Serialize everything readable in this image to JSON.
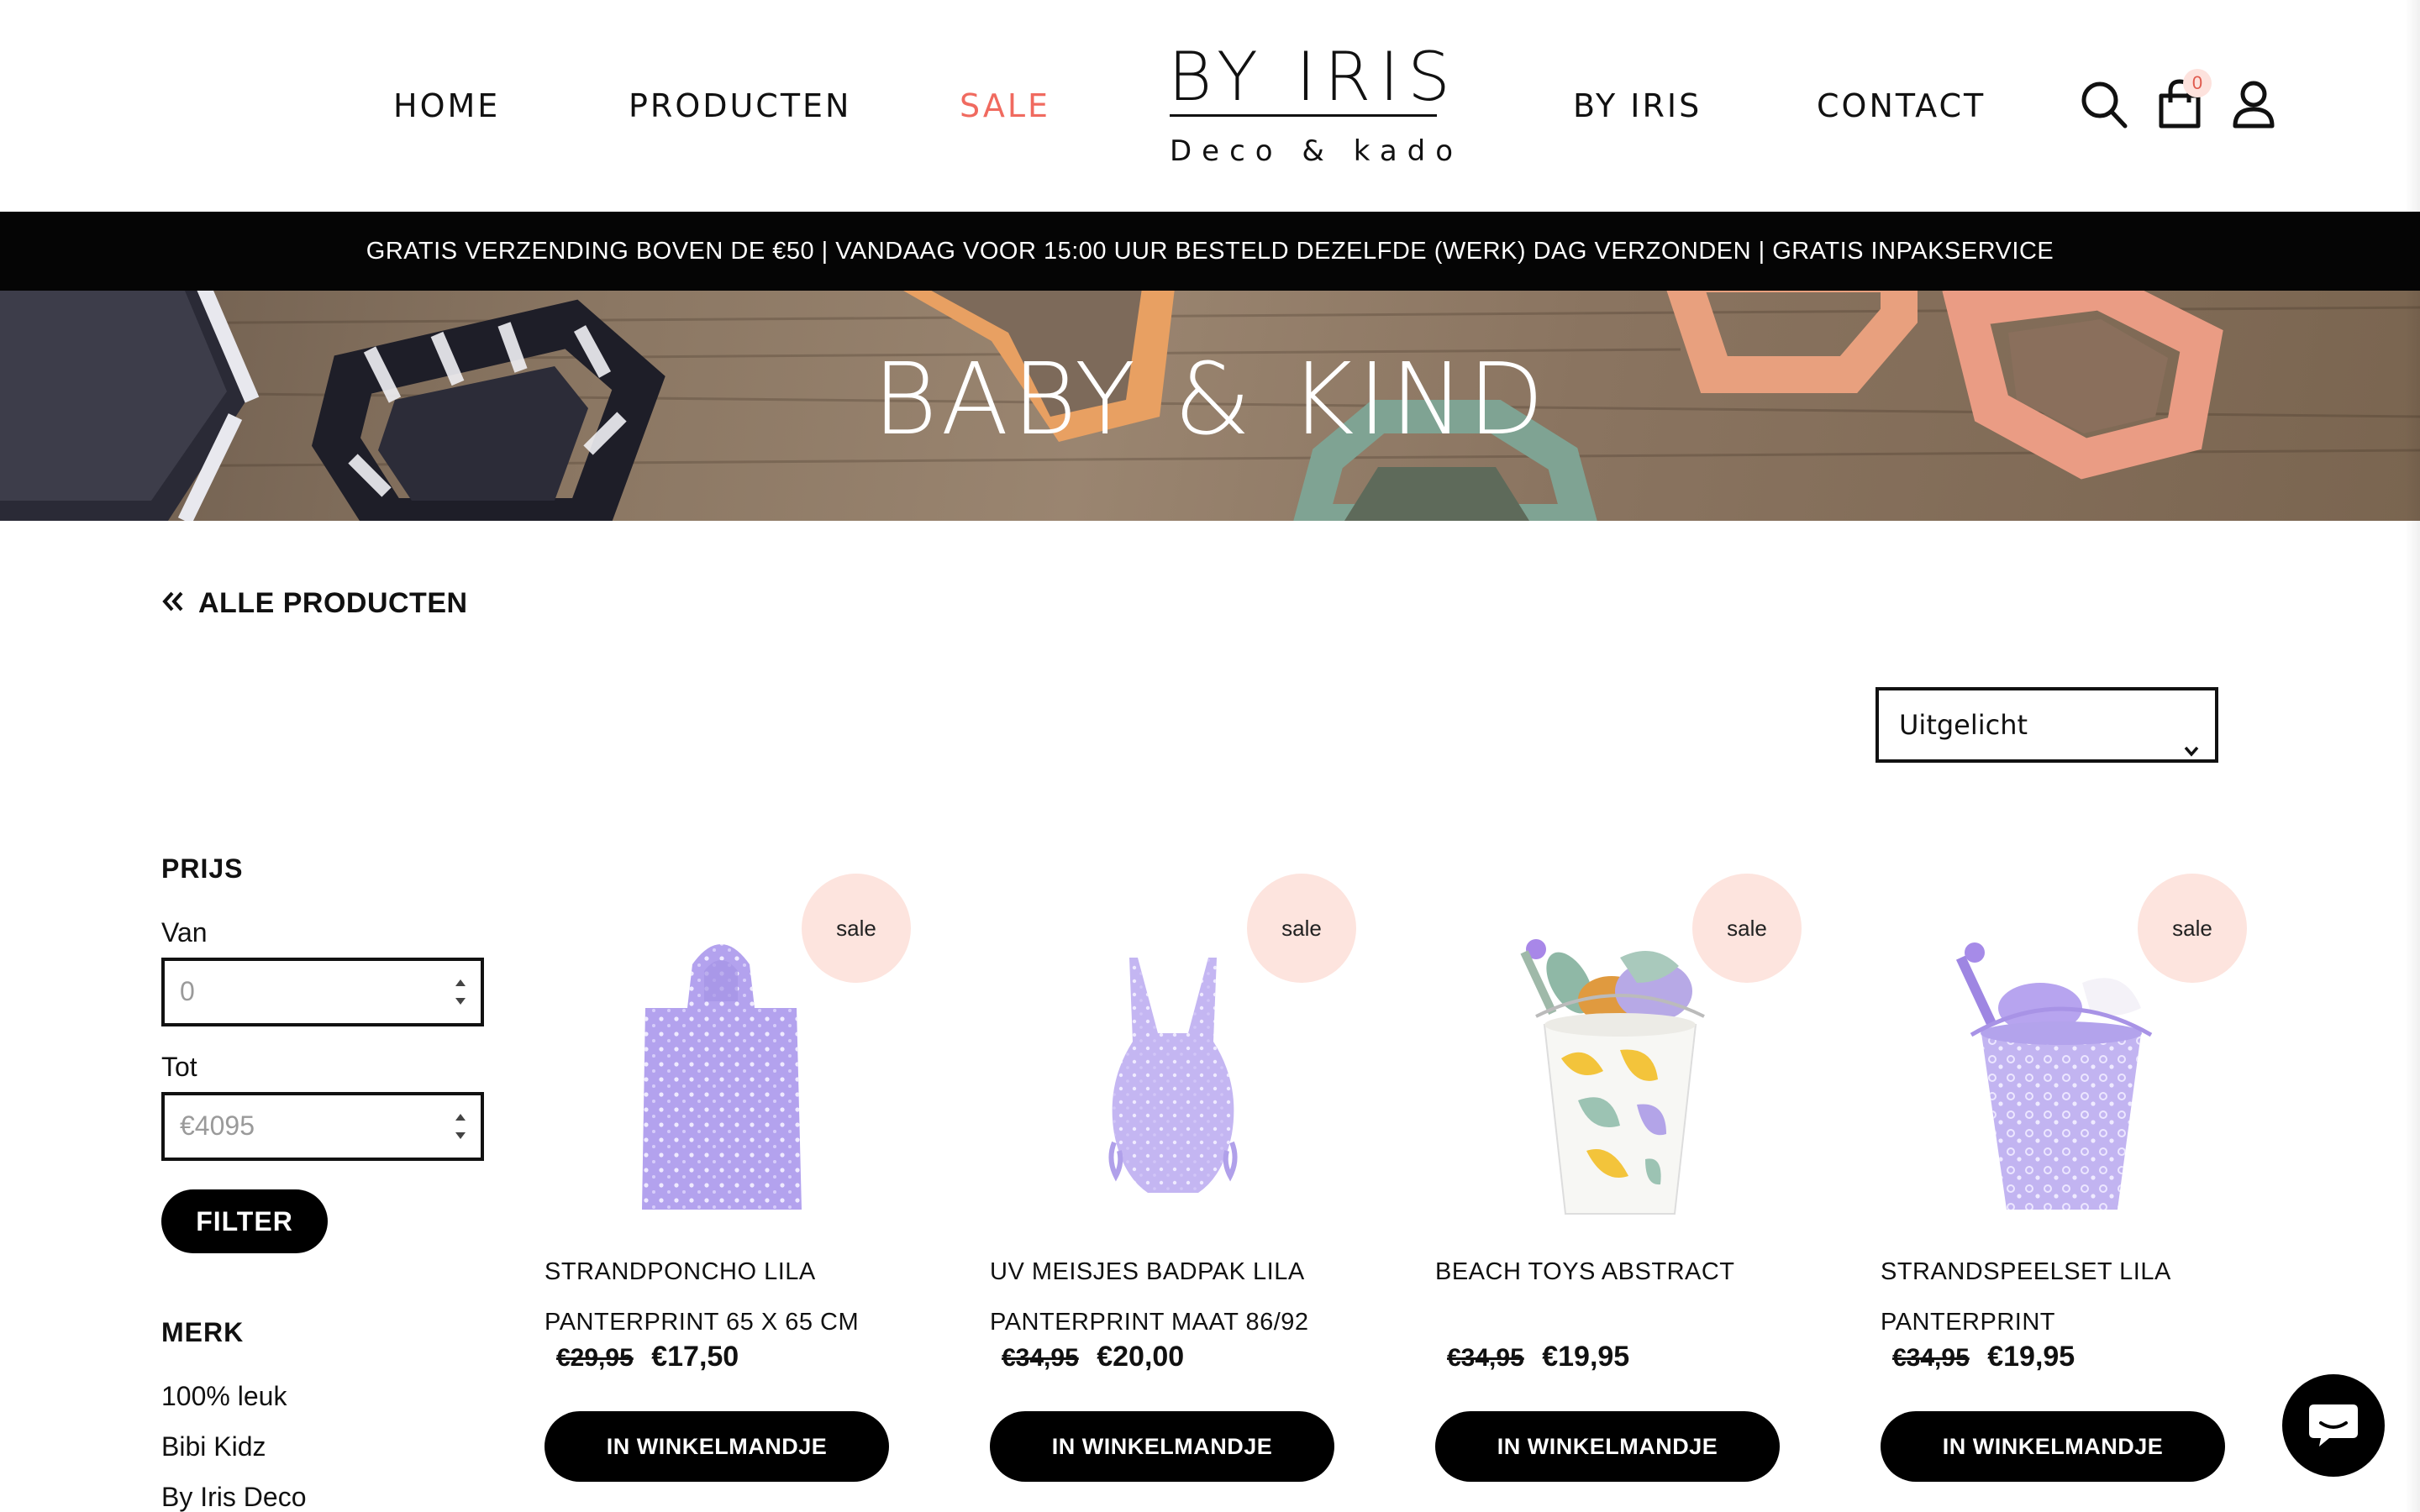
{
  "nav": {
    "home": "HOME",
    "producten": "PRODUCTEN",
    "sale": "SALE",
    "by_iris": "BY IRIS",
    "contact": "CONTACT"
  },
  "logo": {
    "top": "BY IRIS",
    "bottom": "Deco & kado"
  },
  "header_icons": {
    "search": "search-icon",
    "cart": "shopping-bag-icon",
    "account": "user-icon",
    "cart_count": "0"
  },
  "announcement": "GRATIS VERZENDING BOVEN DE €50 | VANDAAG VOOR 15:00 UUR BESTELD DEZELFDE (WERK) DAG VERZONDEN | GRATIS INPAKSERVICE",
  "hero": {
    "title": "BABY & KIND"
  },
  "breadcrumb": {
    "back_label": "ALLE PRODUCTEN"
  },
  "sort": {
    "selected": "Uitgelicht"
  },
  "filters": {
    "price_heading": "PRIJS",
    "from_label": "Van",
    "from_placeholder": "0",
    "to_label": "Tot",
    "to_placeholder": "€4095",
    "filter_button": "FILTER",
    "brand_heading": "MERK",
    "brands": [
      "100% leuk",
      "Bibi Kidz",
      "By Iris Deco"
    ]
  },
  "products": [
    {
      "badge": "sale",
      "name_line1": "STRANDPONCHO LILA",
      "name_line2": "PANTERPRINT 65 X 65 CM",
      "old_price": "€29,95",
      "price": "€17,50",
      "button": "IN WINKELMANDJE"
    },
    {
      "badge": "sale",
      "name_line1": "UV MEISJES BADPAK LILA",
      "name_line2": "PANTERPRINT MAAT 86/92",
      "old_price": "€34,95",
      "price": "€20,00",
      "button": "IN WINKELMANDJE"
    },
    {
      "badge": "sale",
      "name_line1": "BEACH TOYS ABSTRACT",
      "name_line2": "",
      "old_price": "€34,95",
      "price": "€19,95",
      "button": "IN WINKELMANDJE"
    },
    {
      "badge": "sale",
      "name_line1": "STRANDSPEELSET LILA",
      "name_line2": "PANTERPRINT",
      "old_price": "€34,95",
      "price": "€19,95",
      "button": "IN WINKELMANDJE"
    }
  ],
  "colors": {
    "sale_nav": "#f06a5f",
    "badge_bg": "#fde4de",
    "button_bg": "#000000",
    "lilac": "#b9a8ee"
  },
  "chat_icon": "chat-bubble-icon"
}
